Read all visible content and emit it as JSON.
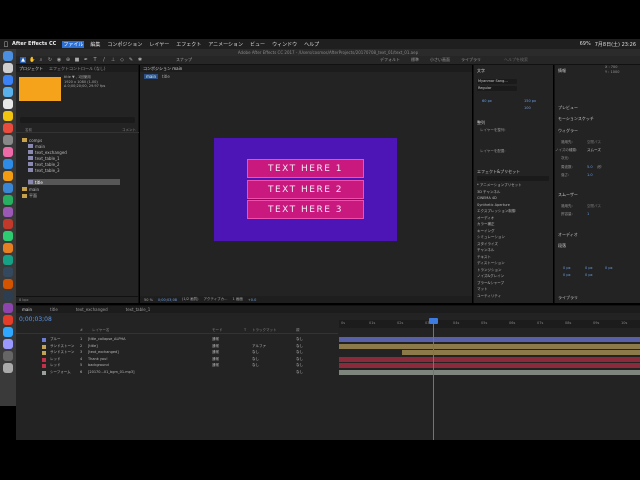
{
  "menubar": {
    "app": "After Effects CC",
    "items": [
      "ファイル",
      "編集",
      "コンポジション",
      "レイヤー",
      "エフェクト",
      "アニメーション",
      "ビュー",
      "ウィンドウ",
      "ヘルプ"
    ],
    "active_item": "ファイル",
    "right": [
      "69%",
      "7月8日(土) 23:26"
    ]
  },
  "titlebar": "Adobe After Effects CC 2017 - /Users/cosmos/AfterProjects/20170708_text_01/text_01.aep",
  "toolbar": {
    "snap_label": "スナップ",
    "workspaces": [
      "デフォルト",
      "標準",
      "小さい画面",
      "ライブラリ"
    ],
    "search_placeholder": "ヘルプを検索"
  },
  "project": {
    "tabs": [
      "プロジェクト",
      "エフェクトコントロール (なし)"
    ],
    "info_lines": [
      "title ▼ , 1回使用",
      "1920 x 1080 (1.00)",
      "Δ 0;00;20;00, 29.97 fps"
    ],
    "col_header": "名前",
    "col_header2": "コメント",
    "items": [
      {
        "name": "comps",
        "type": "folder"
      },
      {
        "name": "main",
        "type": "comp"
      },
      {
        "name": "text_exchanged",
        "type": "comp"
      },
      {
        "name": "text_table_1",
        "type": "comp"
      },
      {
        "name": "text_table_2",
        "type": "comp"
      },
      {
        "name": "text_table_3",
        "type": "comp"
      },
      {
        "name": "title",
        "type": "comp"
      },
      {
        "name": "main",
        "type": "folder"
      },
      {
        "name": "平面",
        "type": "folder"
      }
    ],
    "selected_index": 6,
    "footer": "8 bpc"
  },
  "composition": {
    "tab_label": "コンポジション main",
    "breadcrumb": [
      "main",
      "title"
    ],
    "text_boxes": [
      "TEXT HERE 1",
      "TEXT HERE 2",
      "TEXT HERE 3"
    ],
    "footer": {
      "zoom": "50 %",
      "timecode": "0;00;03;08",
      "resolution": "(1/2 画質)",
      "camera": "アクティブカ...",
      "views": "1 画面",
      "offset": "+0.0"
    }
  },
  "character": {
    "title": "文字",
    "font": "Myanmar Sang...",
    "style": "Regular",
    "size": "60 px",
    "leading": "150 px",
    "tracking": "100"
  },
  "info_panel": {
    "title": "情報",
    "values": [
      "X : 700",
      "Y : 1000"
    ],
    "preview": "プレビュー",
    "motion_sketch": "モーションスケッチ"
  },
  "align_panel": {
    "title": "整列",
    "layer_align": "レイヤーを整列:",
    "distribute": "レイヤーを配置:"
  },
  "wiggler": {
    "title": "ウィグラー",
    "apply_to": "適用先:",
    "apply_value": "空間パス",
    "noise": "ノイズの種類:",
    "noise_value": "スムーズ",
    "dimension": "次元:",
    "freq": "周波数:",
    "freq_value": "5.0",
    "freq_unit": "/秒",
    "magnitude": "強さ:",
    "magnitude_value": "1.0"
  },
  "smoother": {
    "title": "スムーザー",
    "apply_to": "適用先:",
    "apply_value": "空間パス",
    "tolerance": "許容量:",
    "tolerance_value": "1"
  },
  "orient": "オーディオ",
  "paragraph": {
    "title": "段落",
    "values": [
      "0 px",
      "0 px",
      "0 px",
      "0 px",
      "0 px"
    ]
  },
  "library_label": "ライブラリ",
  "effects_presets": {
    "title": "エフェクト&プリセット",
    "items": [
      "* アニメーションプリセット",
      "3D チャンネル",
      "CINEMA 4D",
      "Synthetic Aperture",
      "エクスプレッション制御",
      "オーディオ",
      "カラー補正",
      "キーイング",
      "シミュレーション",
      "スタイライズ",
      "チャンネル",
      "テキスト",
      "ディストーション",
      "トランジション",
      "ノイズ&グレイン",
      "ブラー&シャープ",
      "マット",
      "ユーティリティ"
    ]
  },
  "timeline": {
    "tabs": [
      "main",
      "title",
      "text_exchanged",
      "text_table_1"
    ],
    "timecode": "0;00;03;08",
    "columns": [
      "#",
      "レイヤー名",
      "モード",
      "T",
      "トラックマット",
      "親"
    ],
    "layers": [
      {
        "num": "1",
        "name": "[title_collapse_ALPHA",
        "color": "#6b7cd6",
        "label": "ブルー",
        "mode": "通常",
        "track": "",
        "parent": "なし"
      },
      {
        "num": "2",
        "name": "[title]",
        "color": "#c2a253",
        "label": "サンドストーン",
        "mode": "通常",
        "track": "アルファ",
        "parent": "なし"
      },
      {
        "num": "3",
        "name": "[text_exchanged]",
        "color": "#c2a253",
        "label": "サンドストーン",
        "mode": "通常",
        "track": "なし",
        "parent": "なし"
      },
      {
        "num": "4",
        "name": "Thank you!",
        "color": "#c4304a",
        "label": "レッド",
        "mode": "通常",
        "track": "なし",
        "parent": "なし"
      },
      {
        "num": "5",
        "name": "background",
        "color": "#c4304a",
        "label": "レッド",
        "mode": "通常",
        "track": "なし",
        "parent": "なし"
      },
      {
        "num": "6",
        "name": "[20170...01_bgm_01.mp3]",
        "color": "#9aa09a",
        "label": "シーフォーム",
        "mode": "",
        "track": "",
        "parent": "なし"
      }
    ],
    "ruler_ticks": [
      "0s",
      "01s",
      "02s",
      "03s",
      "04s",
      "05s",
      "06s",
      "07s",
      "08s",
      "09s",
      "10s"
    ]
  }
}
